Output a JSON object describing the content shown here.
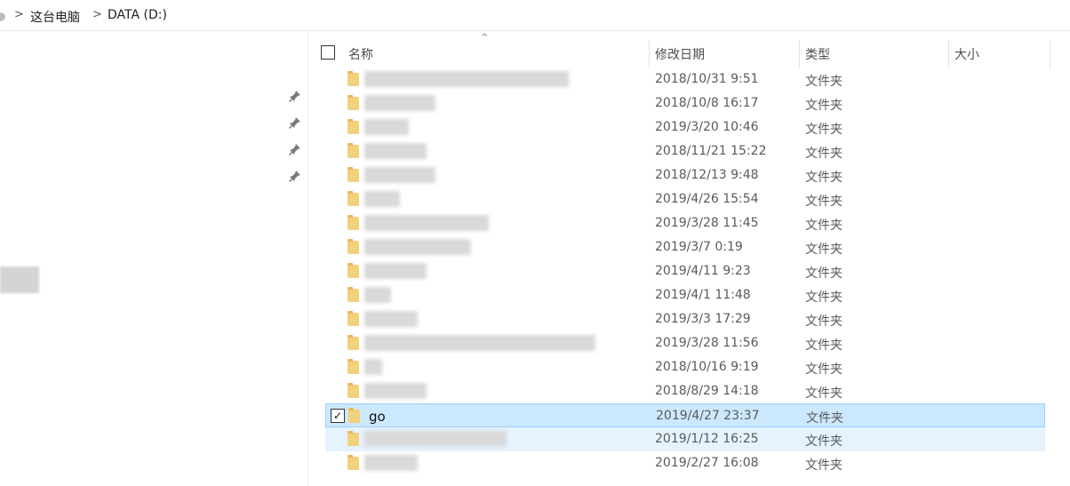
{
  "address": {
    "crumbs": [
      "这台电脑",
      "DATA (D:)"
    ],
    "separator": ">"
  },
  "header": {
    "name": "名称",
    "modified": "修改日期",
    "type": "类型",
    "size": "大小",
    "sort_indicator": "^"
  },
  "rows": [
    {
      "name": "",
      "date": "2018/10/31 9:51",
      "type": "文件夹",
      "size": ""
    },
    {
      "name": "",
      "date": "2018/10/8 16:17",
      "type": "文件夹",
      "size": ""
    },
    {
      "name": "",
      "date": "2019/3/20 10:46",
      "type": "文件夹",
      "size": ""
    },
    {
      "name": "",
      "date": "2018/11/21 15:22",
      "type": "文件夹",
      "size": ""
    },
    {
      "name": "",
      "date": "2018/12/13 9:48",
      "type": "文件夹",
      "size": ""
    },
    {
      "name": "",
      "date": "2019/4/26 15:54",
      "type": "文件夹",
      "size": ""
    },
    {
      "name": "",
      "date": "2019/3/28 11:45",
      "type": "文件夹",
      "size": ""
    },
    {
      "name": "",
      "date": "2019/3/7 0:19",
      "type": "文件夹",
      "size": ""
    },
    {
      "name": "",
      "date": "2019/4/11 9:23",
      "type": "文件夹",
      "size": ""
    },
    {
      "name": "",
      "date": "2019/4/1 11:48",
      "type": "文件夹",
      "size": ""
    },
    {
      "name": "",
      "date": "2019/3/3 17:29",
      "type": "文件夹",
      "size": ""
    },
    {
      "name": "",
      "date": "2019/3/28 11:56",
      "type": "文件夹",
      "size": ""
    },
    {
      "name": "",
      "date": "2018/10/16 9:19",
      "type": "文件夹",
      "size": ""
    },
    {
      "name": "",
      "date": "2018/8/29 14:18",
      "type": "文件夹",
      "size": ""
    },
    {
      "name": "go",
      "date": "2019/4/27 23:37",
      "type": "文件夹",
      "size": ""
    },
    {
      "name": "",
      "date": "2019/1/12 16:25",
      "type": "文件夹",
      "size": ""
    },
    {
      "name": "",
      "date": "2019/2/27 16:08",
      "type": "文件夹",
      "size": ""
    }
  ],
  "selected_row": "go",
  "colors": {
    "selected_bg": "#cce8ff",
    "hover_bg": "#e5f3ff",
    "folder": "#f2d17d"
  },
  "icons": [
    "chevron-right-icon",
    "pin-icon",
    "folder-icon",
    "checkbox-icon"
  ]
}
